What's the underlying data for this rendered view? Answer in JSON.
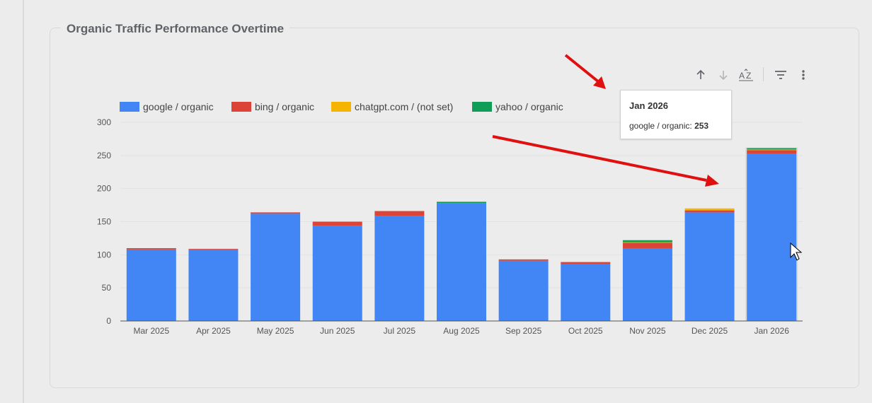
{
  "card": {
    "title": "Organic Traffic Performance Overtime"
  },
  "toolbar": [
    {
      "name": "sort-ascending-icon",
      "glyph": "↑",
      "enabled": true
    },
    {
      "name": "sort-descending-icon",
      "glyph": "↓",
      "enabled": false
    },
    {
      "name": "sort-alphabetical-icon",
      "glyph": "AZ",
      "enabled": true
    },
    {
      "name": "filter-icon",
      "glyph": "filter",
      "enabled": true
    },
    {
      "name": "more-options-icon",
      "glyph": "⋮",
      "enabled": true
    }
  ],
  "tooltip": {
    "title": "Jan 2026",
    "series": "google / organic:",
    "value": "253"
  },
  "colors": {
    "google": "#4285f4",
    "bing": "#db4437",
    "chatgpt": "#f4b400",
    "yahoo": "#0f9d58",
    "arrow": "#e01010",
    "grid": "#e2e2e2",
    "axis": "#555555"
  },
  "chart_data": {
    "type": "bar",
    "stacked": true,
    "categories": [
      "Mar 2025",
      "Apr 2025",
      "May 2025",
      "Jun 2025",
      "Jul 2025",
      "Aug 2025",
      "Sep 2025",
      "Oct 2025",
      "Nov 2025",
      "Dec 2025",
      "Jan 2026"
    ],
    "series": [
      {
        "name": "google / organic",
        "color": "#4285f4",
        "values": [
          108,
          108,
          162,
          144,
          159,
          178,
          91,
          86,
          110,
          164,
          253
        ]
      },
      {
        "name": "bing / organic",
        "color": "#db4437",
        "values": [
          2,
          1,
          2,
          6,
          7,
          0,
          2,
          3,
          8,
          3,
          5
        ]
      },
      {
        "name": "chatgpt.com / (not set)",
        "color": "#f4b400",
        "values": [
          0,
          0,
          0,
          0,
          0,
          0,
          0,
          0,
          1,
          3,
          1
        ]
      },
      {
        "name": "yahoo / organic",
        "color": "#0f9d58",
        "values": [
          0,
          0,
          0,
          0,
          0,
          2,
          0,
          0,
          3,
          0,
          2
        ]
      }
    ],
    "yticks": [
      0,
      50,
      100,
      150,
      200,
      250,
      300
    ],
    "ylim": [
      0,
      300
    ],
    "legend_position": "top-left",
    "grid": true,
    "highlighted_category": "Jan 2026"
  }
}
